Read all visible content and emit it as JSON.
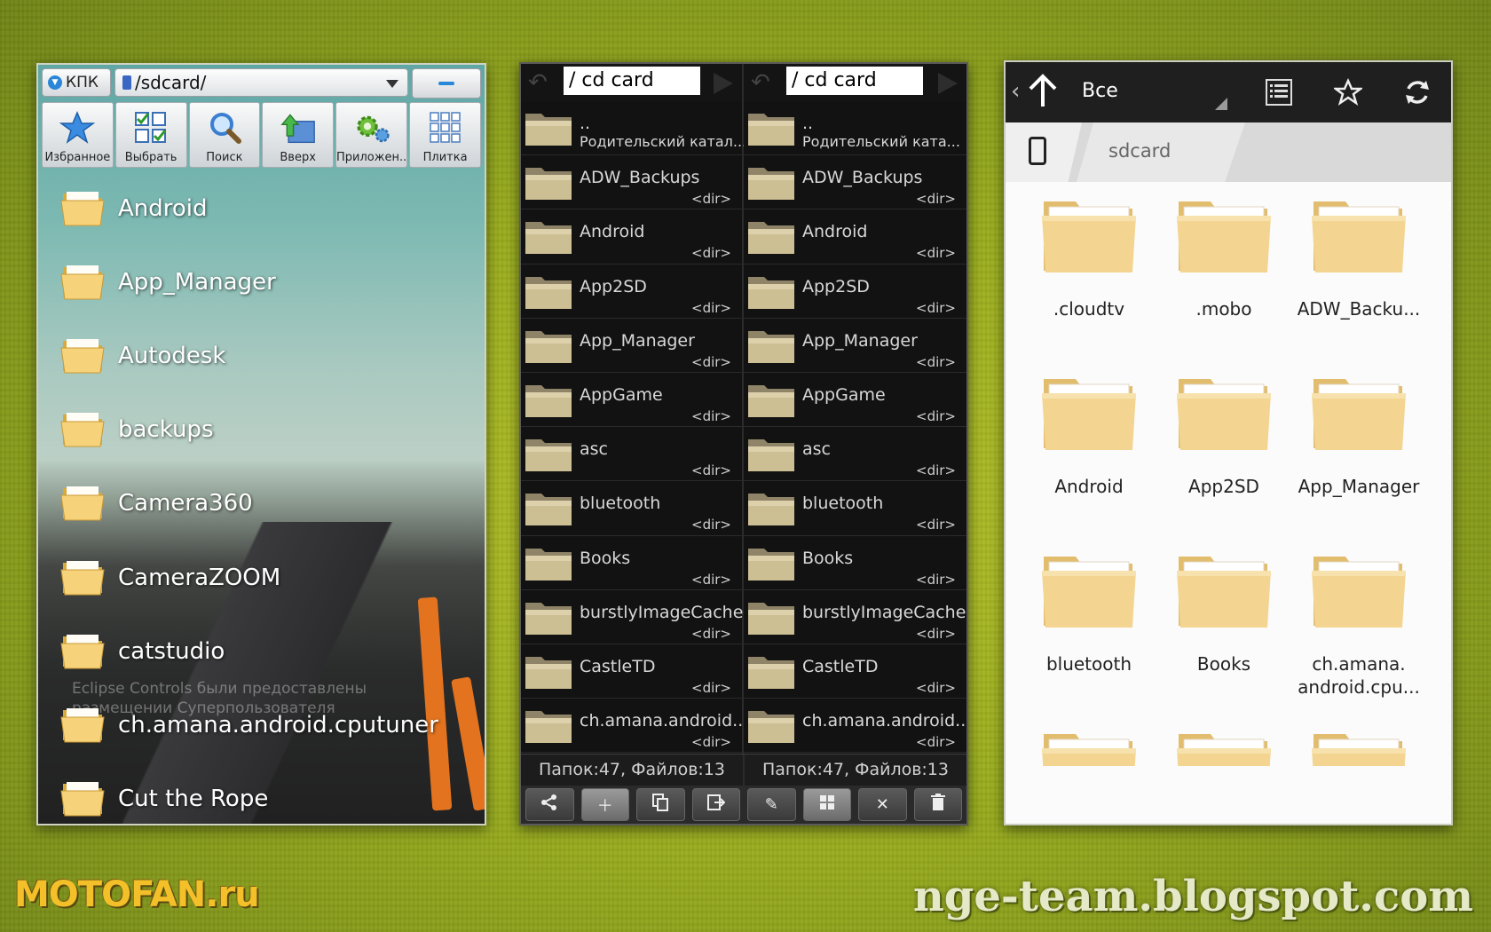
{
  "colors": {
    "background": "#9aad1e",
    "folder": "#f2cd7a",
    "panel2_bg": "#0e0e0e",
    "accent_blue": "#2a86d8"
  },
  "panel1": {
    "location_button": "КПК",
    "path": "/sdcard/",
    "toolbar": [
      {
        "label": "Избранное",
        "icon": "star-icon"
      },
      {
        "label": "Выбрать",
        "icon": "checklist-icon"
      },
      {
        "label": "Поиск",
        "icon": "magnifier-icon"
      },
      {
        "label": "Вверх",
        "icon": "folder-up-icon"
      },
      {
        "label": "Приложен..",
        "icon": "gears-icon"
      },
      {
        "label": "Плитка",
        "icon": "tiles-icon"
      }
    ],
    "folders": [
      "Android",
      "App_Manager",
      "Autodesk",
      "backups",
      "Camera360",
      "CameraZOOM",
      "catstudio",
      "ch.amana.android.cputuner",
      "Cut the Rope"
    ],
    "ghost_text_1": "Eclipse Controls были предоставлены",
    "ghost_text_2": "размещении Суперпользователя"
  },
  "panel2": {
    "path": "/ cd card",
    "parent_name": "..",
    "parent_label_left": "Родительский катал...",
    "parent_label_right": "Родительский ката...",
    "dir_tag": "<dir>",
    "folders_left": [
      "ADW_Backups",
      "Android",
      "App2SD",
      "App_Manager",
      "AppGame",
      "asc",
      "bluetooth",
      "Books",
      "burstlyImageCache",
      "CastleTD",
      "ch.amana.android...."
    ],
    "folders_right": [
      "ADW_Backups",
      "Android",
      "App2SD",
      "App_Manager",
      "AppGame",
      "asc",
      "bluetooth",
      "Books",
      "burstlyImageCache",
      "CastleTD",
      "ch.amana.android...."
    ],
    "status": "Папок:47, Файлов:13",
    "bottom_icons": [
      "share-icon",
      "plus-icon",
      "copy-icon",
      "move-icon",
      "pencil-icon",
      "grid-icon",
      "close-icon",
      "trash-icon"
    ]
  },
  "panel3": {
    "filter": "Все",
    "breadcrumb": "sdcard",
    "items": [
      ".cloudtv",
      ".mobo",
      "ADW_Backu...",
      "Android",
      "App2SD",
      "App_Manager",
      "bluetooth",
      "Books",
      "ch.amana.\nandroid.cpu..."
    ]
  },
  "watermark_left": "MOTOFAN.ru",
  "watermark_right": "nge-team.blogspot.com"
}
